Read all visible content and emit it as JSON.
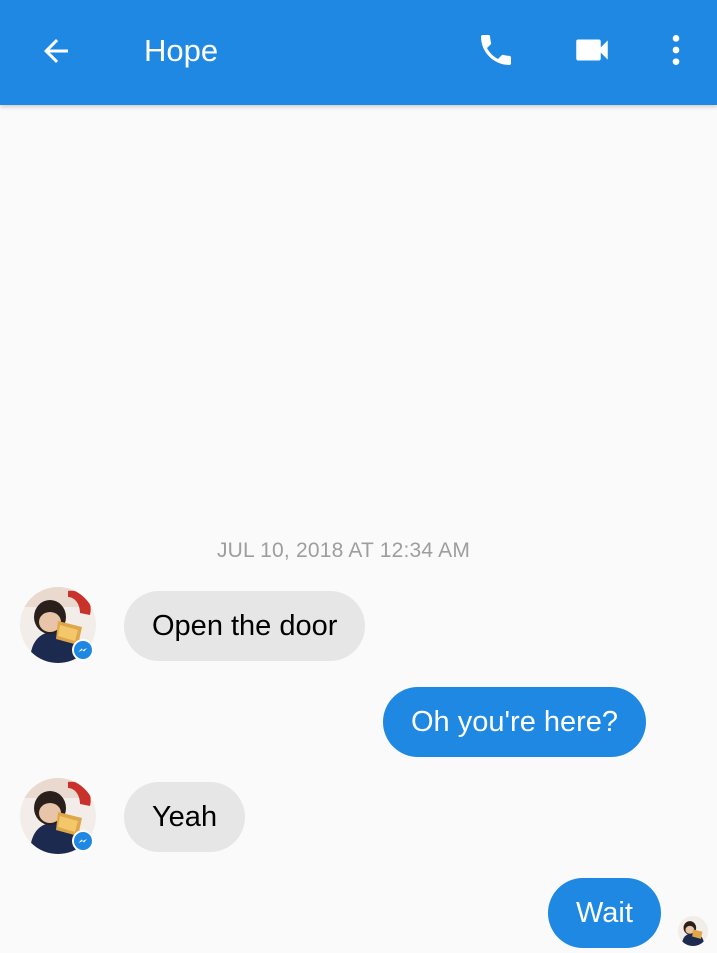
{
  "app_bar": {
    "title": "Hope",
    "background_color": "#1e88e2",
    "icons": {
      "back": "arrow-back-icon",
      "call": "phone-icon",
      "video": "video-camera-icon",
      "more": "more-vertical-icon"
    }
  },
  "thread": {
    "timestamp": "JUL 10, 2018 AT 12:34 AM",
    "messages": [
      {
        "direction": "incoming",
        "text": "Open the door"
      },
      {
        "direction": "outgoing",
        "text": "Oh you're here?"
      },
      {
        "direction": "incoming",
        "text": "Yeah"
      },
      {
        "direction": "outgoing",
        "text": "Wait"
      }
    ],
    "colors": {
      "incoming_bubble": "#e6e6e6",
      "outgoing_bubble": "#1e88e2",
      "timestamp_text": "#9e9e9e"
    }
  }
}
